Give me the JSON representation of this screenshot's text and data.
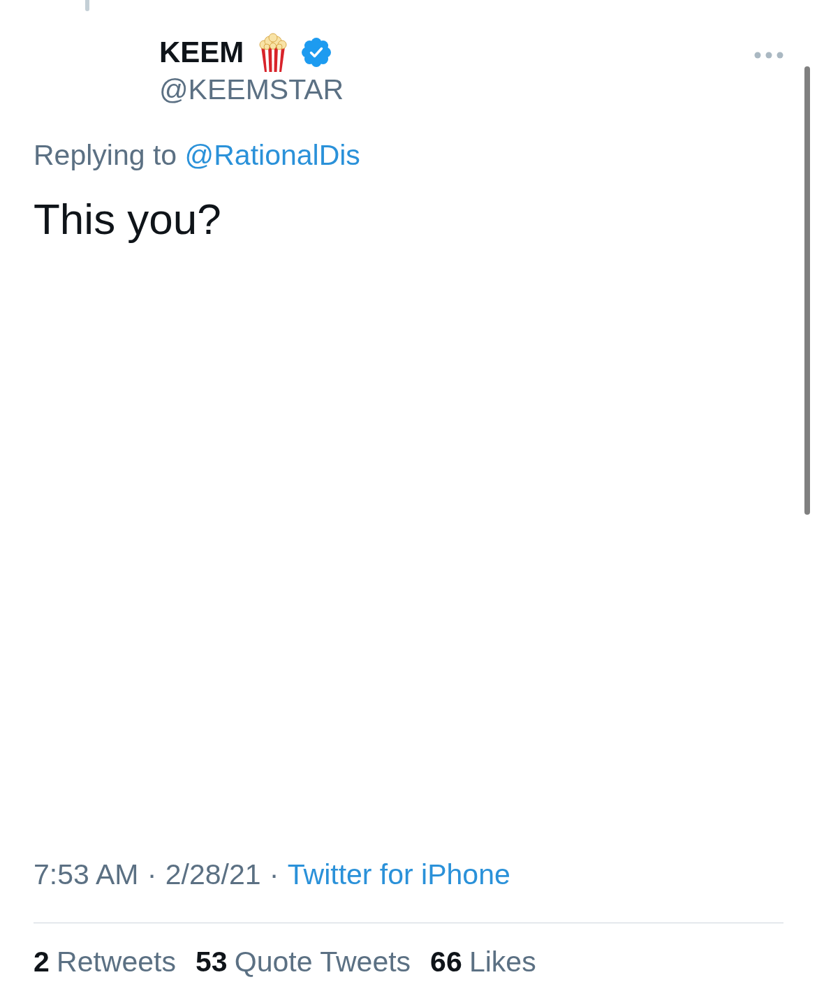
{
  "tweet": {
    "connector_above": true,
    "author": {
      "display_name": "KEEM",
      "handle": "@KEEMSTAR",
      "verified": true
    },
    "reply_context": {
      "label": "Replying to",
      "mention": "@RationalDis"
    },
    "text": "This you?",
    "meta": [
      {
        "kind": "time",
        "text": "7:53 AM"
      },
      {
        "kind": "separator",
        "text": "·"
      },
      {
        "kind": "date",
        "text": "2/28/21"
      },
      {
        "kind": "separator",
        "text": "·"
      },
      {
        "kind": "source",
        "text": "Twitter for iPhone"
      }
    ],
    "stats": [
      {
        "count": "2",
        "label": "Retweets"
      },
      {
        "count": "53",
        "label": "Quote Tweets"
      },
      {
        "count": "66",
        "label": "Likes"
      }
    ]
  }
}
